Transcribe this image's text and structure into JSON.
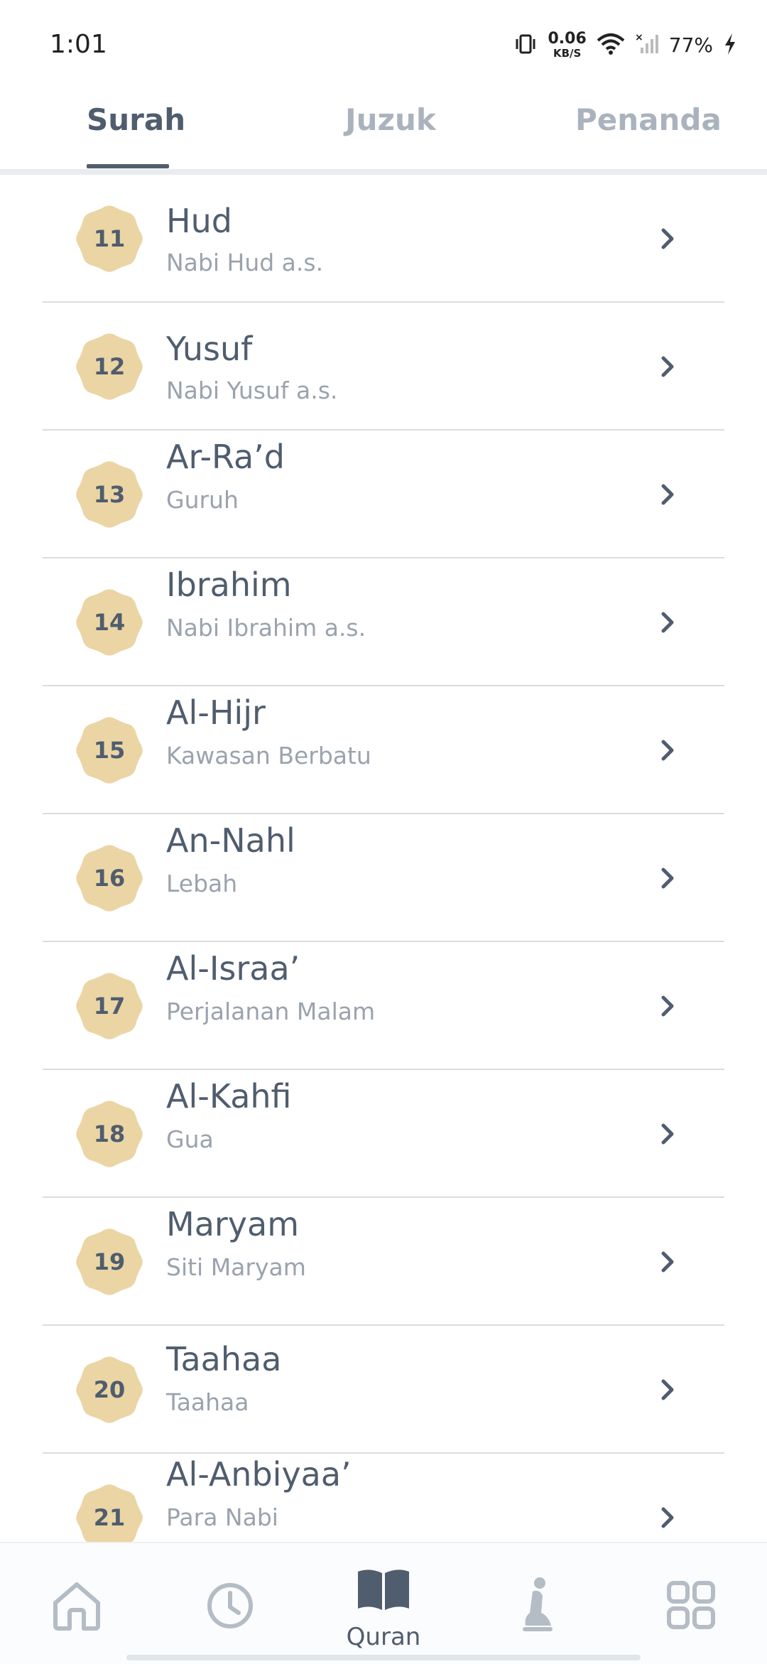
{
  "status_bar": {
    "time": "1:01",
    "net_speed_value": "0.06",
    "net_speed_unit": "KB/S",
    "battery_percent": "77%",
    "icons": [
      "vibrate-icon",
      "wifi-icon",
      "cellular-no-signal-icon",
      "battery-charging-icon"
    ]
  },
  "tabs": [
    {
      "label": "Surah",
      "active": true
    },
    {
      "label": "Juzuk",
      "active": false
    },
    {
      "label": "Penanda",
      "active": false
    }
  ],
  "surah_list": [
    {
      "number": "11",
      "name": "Hud",
      "meaning": "Nabi Hud a.s."
    },
    {
      "number": "12",
      "name": "Yusuf",
      "meaning": "Nabi Yusuf a.s."
    },
    {
      "number": "13",
      "name": "Ar-Ra’d",
      "meaning": "Guruh"
    },
    {
      "number": "14",
      "name": "Ibrahim",
      "meaning": "Nabi Ibrahim a.s."
    },
    {
      "number": "15",
      "name": "Al-Hijr",
      "meaning": "Kawasan Berbatu"
    },
    {
      "number": "16",
      "name": "An-Nahl",
      "meaning": "Lebah"
    },
    {
      "number": "17",
      "name": "Al-Israa’",
      "meaning": "Perjalanan Malam"
    },
    {
      "number": "18",
      "name": "Al-Kahfi",
      "meaning": "Gua"
    },
    {
      "number": "19",
      "name": "Maryam",
      "meaning": "Siti Maryam"
    },
    {
      "number": "20",
      "name": "Taahaa",
      "meaning": "Taahaa"
    },
    {
      "number": "21",
      "name": "Al-Anbiyaa’",
      "meaning": "Para Nabi"
    }
  ],
  "bottom_nav": {
    "items": [
      {
        "icon": "home-icon",
        "label": ""
      },
      {
        "icon": "clock-icon",
        "label": ""
      },
      {
        "icon": "open-book-icon",
        "label": "Quran",
        "active": true
      },
      {
        "icon": "prayer-person-icon",
        "label": ""
      },
      {
        "icon": "grid-icon",
        "label": ""
      }
    ]
  },
  "colors": {
    "text_primary": "#4f5d6e",
    "text_secondary": "#9aa3ad",
    "tab_inactive": "#aab3bd",
    "badge": "#ebd5a4",
    "divider": "#d9dde2"
  }
}
